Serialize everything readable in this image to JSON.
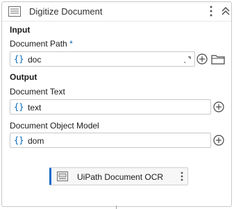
{
  "activity": {
    "title": "Digitize Document",
    "icon": "document-lines-icon"
  },
  "input": {
    "section_label": "Input",
    "document_path": {
      "label": "Document Path",
      "required_mark": "*",
      "brace": "{}",
      "value": "doc"
    }
  },
  "output": {
    "section_label": "Output",
    "document_text": {
      "label": "Document Text",
      "brace": "{}",
      "value": "text"
    },
    "document_object_model": {
      "label": "Document Object Model",
      "brace": "{}",
      "value": "dom"
    }
  },
  "child_activity": {
    "title": "UiPath Document OCR",
    "icon": "ocr-scanner-icon"
  },
  "colors": {
    "accent": "#0067b8",
    "child_border": "#1b6ac9"
  }
}
